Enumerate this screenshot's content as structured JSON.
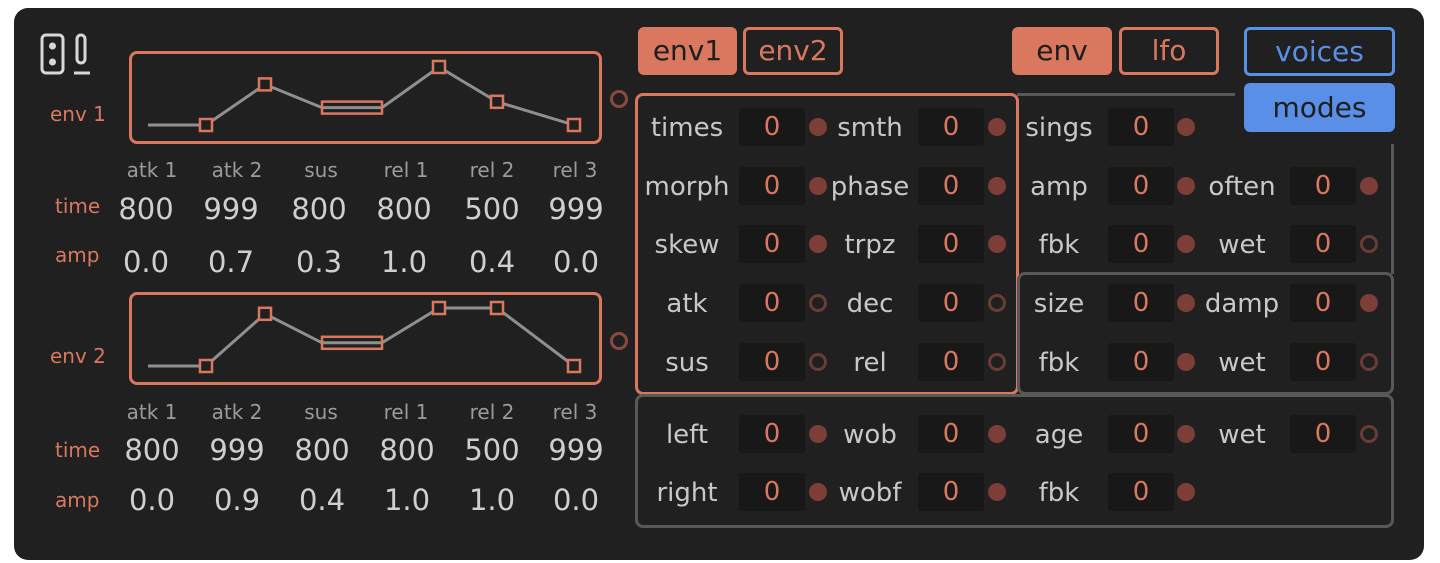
{
  "tabs": {
    "env1": "env1",
    "env2": "env2",
    "env": "env",
    "lfo": "lfo",
    "voices": "voices",
    "modes": "modes"
  },
  "envelopes": [
    {
      "label": "env 1",
      "segments": [
        "atk 1",
        "atk 2",
        "sus",
        "rel 1",
        "rel 2",
        "rel 3"
      ],
      "time_label": "time",
      "amp_label": "amp",
      "time": [
        "800",
        "999",
        "800",
        "800",
        "500",
        "999"
      ],
      "amp": [
        "0.0",
        "0.7",
        "0.3",
        "1.0",
        "0.4",
        "0.0"
      ],
      "amp_values": [
        0.0,
        0.7,
        0.3,
        1.0,
        0.4,
        0.0
      ]
    },
    {
      "label": "env 2",
      "segments": [
        "atk 1",
        "atk 2",
        "sus",
        "rel 1",
        "rel 2",
        "rel 3"
      ],
      "time_label": "time",
      "amp_label": "amp",
      "time": [
        "800",
        "999",
        "800",
        "800",
        "500",
        "999"
      ],
      "amp": [
        "0.0",
        "0.9",
        "0.4",
        "1.0",
        "1.0",
        "0.0"
      ],
      "amp_values": [
        0.0,
        0.9,
        0.4,
        1.0,
        1.0,
        0.0
      ]
    }
  ],
  "params": [
    {
      "label": "times",
      "value": "0"
    },
    {
      "label": "smth",
      "value": "0"
    },
    {
      "label": "morph",
      "value": "0"
    },
    {
      "label": "phase",
      "value": "0"
    },
    {
      "label": "skew",
      "value": "0"
    },
    {
      "label": "trpz",
      "value": "0"
    },
    {
      "label": "atk",
      "value": "0"
    },
    {
      "label": "dec",
      "value": "0"
    },
    {
      "label": "sus",
      "value": "0"
    },
    {
      "label": "rel",
      "value": "0"
    },
    {
      "label": "sings",
      "value": "0"
    },
    {
      "label": "amp",
      "value": "0"
    },
    {
      "label": "often",
      "value": "0"
    },
    {
      "label": "fbk",
      "value": "0"
    },
    {
      "label": "wet",
      "value": "0"
    },
    {
      "label": "size",
      "value": "0"
    },
    {
      "label": "damp",
      "value": "0"
    },
    {
      "label": "fbk",
      "value": "0"
    },
    {
      "label": "wet",
      "value": "0"
    },
    {
      "label": "left",
      "value": "0"
    },
    {
      "label": "wob",
      "value": "0"
    },
    {
      "label": "age",
      "value": "0"
    },
    {
      "label": "wet",
      "value": "0"
    },
    {
      "label": "right",
      "value": "0"
    },
    {
      "label": "wobf",
      "value": "0"
    },
    {
      "label": "fbk",
      "value": "0"
    }
  ],
  "colors": {
    "accent": "#d9785f",
    "blue": "#5a8fe8",
    "background": "#202020",
    "line": "#8f8f8f"
  },
  "icons": {
    "top_left": "device-icon",
    "env_dot": "ring-icon"
  }
}
